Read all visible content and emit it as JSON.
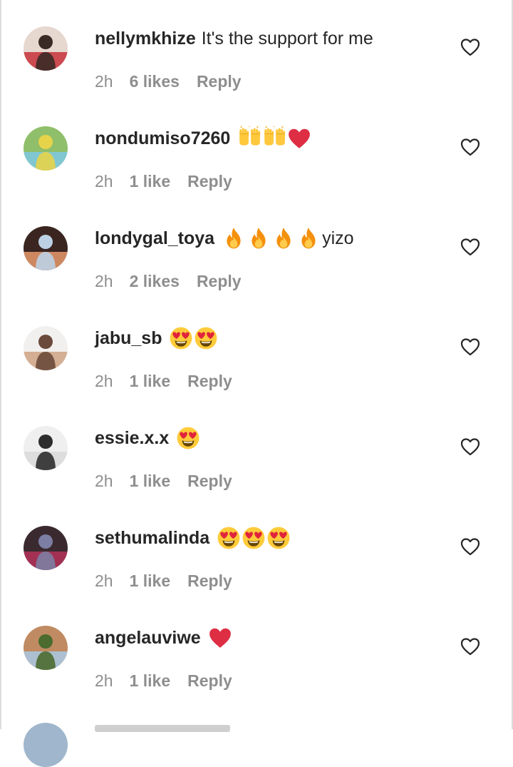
{
  "comments": [
    {
      "username": "nellymkhize",
      "text": "It's the support for me",
      "emojis": [],
      "time": "2h",
      "likes": "6 likes",
      "reply": "Reply",
      "avatar_colors": [
        "#c5333a",
        "#e6d7cf",
        "#3a2a26"
      ]
    },
    {
      "username": "nondumiso7260",
      "text": "",
      "emojis": [
        "raising-hands-icon",
        "raising-hands-icon",
        "red-heart-icon"
      ],
      "time": "2h",
      "likes": "1 like",
      "reply": "Reply",
      "avatar_colors": [
        "#7ec8e3",
        "#8fbf6a",
        "#e7d34a"
      ]
    },
    {
      "username": "londygal_toya",
      "text": "yizo",
      "emojis": [
        "fire-icon",
        "fire-icon",
        "fire-icon",
        "fire-icon"
      ],
      "time": "2h",
      "likes": "2 likes",
      "reply": "Reply",
      "avatar_colors": [
        "#e99a6c",
        "#3a2520",
        "#bcd2e4"
      ]
    },
    {
      "username": "jabu_sb",
      "text": "",
      "emojis": [
        "smiling-face-heart-eyes-icon",
        "smiling-face-heart-eyes-icon"
      ],
      "time": "2h",
      "likes": "1 like",
      "reply": "Reply",
      "avatar_colors": [
        "#cfa383",
        "#f2f0ee",
        "#6b4a3b"
      ]
    },
    {
      "username": "essie.x.x",
      "text": "",
      "emojis": [
        "smiling-face-heart-eyes-icon"
      ],
      "time": "2h",
      "likes": "1 like",
      "reply": "Reply",
      "avatar_colors": [
        "#d9d9d9",
        "#efefef",
        "#2d2d2d"
      ]
    },
    {
      "username": "sethumalinda",
      "text": "",
      "emojis": [
        "smiling-face-heart-eyes-icon",
        "smiling-face-heart-eyes-icon",
        "smiling-face-heart-eyes-icon"
      ],
      "time": "2h",
      "likes": "1 like",
      "reply": "Reply",
      "avatar_colors": [
        "#b5325a",
        "#3a2a30",
        "#7c7fa3"
      ]
    },
    {
      "username": "angelauviwe",
      "text": "",
      "emojis": [
        "red-heart-icon"
      ],
      "time": "2h",
      "likes": "1 like",
      "reply": "Reply",
      "avatar_colors": [
        "#a8c9e6",
        "#c08b62",
        "#4b6b2f"
      ]
    }
  ],
  "like_icon": "heart-outline-icon",
  "colors": {
    "username": "#262626",
    "meta": "#8e8e8e",
    "heart_red": "#e0243c",
    "emoji_yellow": "#ffcb3a",
    "fire_orange": "#f4900c"
  }
}
